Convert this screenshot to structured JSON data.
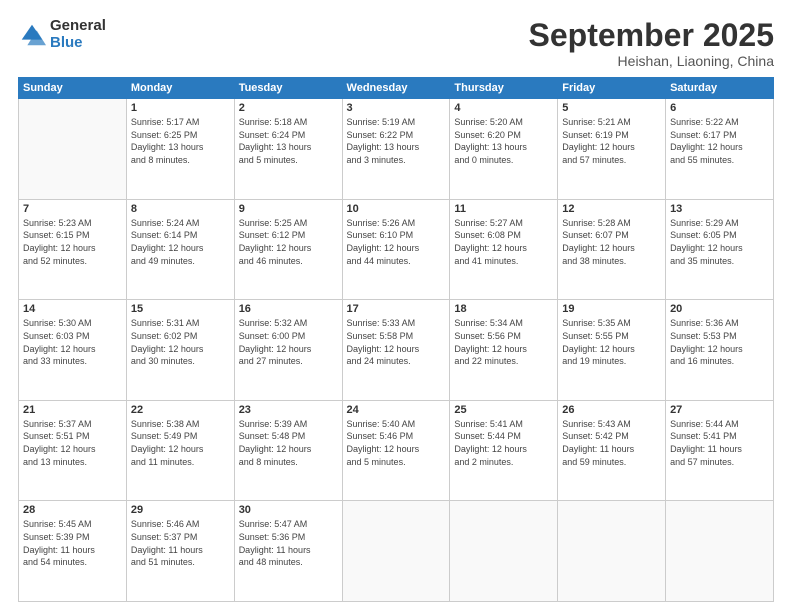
{
  "logo": {
    "general": "General",
    "blue": "Blue"
  },
  "title": "September 2025",
  "location": "Heishan, Liaoning, China",
  "days": [
    "Sunday",
    "Monday",
    "Tuesday",
    "Wednesday",
    "Thursday",
    "Friday",
    "Saturday"
  ],
  "weeks": [
    [
      {
        "date": "",
        "info": ""
      },
      {
        "date": "1",
        "info": "Sunrise: 5:17 AM\nSunset: 6:25 PM\nDaylight: 13 hours\nand 8 minutes."
      },
      {
        "date": "2",
        "info": "Sunrise: 5:18 AM\nSunset: 6:24 PM\nDaylight: 13 hours\nand 5 minutes."
      },
      {
        "date": "3",
        "info": "Sunrise: 5:19 AM\nSunset: 6:22 PM\nDaylight: 13 hours\nand 3 minutes."
      },
      {
        "date": "4",
        "info": "Sunrise: 5:20 AM\nSunset: 6:20 PM\nDaylight: 13 hours\nand 0 minutes."
      },
      {
        "date": "5",
        "info": "Sunrise: 5:21 AM\nSunset: 6:19 PM\nDaylight: 12 hours\nand 57 minutes."
      },
      {
        "date": "6",
        "info": "Sunrise: 5:22 AM\nSunset: 6:17 PM\nDaylight: 12 hours\nand 55 minutes."
      }
    ],
    [
      {
        "date": "7",
        "info": "Sunrise: 5:23 AM\nSunset: 6:15 PM\nDaylight: 12 hours\nand 52 minutes."
      },
      {
        "date": "8",
        "info": "Sunrise: 5:24 AM\nSunset: 6:14 PM\nDaylight: 12 hours\nand 49 minutes."
      },
      {
        "date": "9",
        "info": "Sunrise: 5:25 AM\nSunset: 6:12 PM\nDaylight: 12 hours\nand 46 minutes."
      },
      {
        "date": "10",
        "info": "Sunrise: 5:26 AM\nSunset: 6:10 PM\nDaylight: 12 hours\nand 44 minutes."
      },
      {
        "date": "11",
        "info": "Sunrise: 5:27 AM\nSunset: 6:08 PM\nDaylight: 12 hours\nand 41 minutes."
      },
      {
        "date": "12",
        "info": "Sunrise: 5:28 AM\nSunset: 6:07 PM\nDaylight: 12 hours\nand 38 minutes."
      },
      {
        "date": "13",
        "info": "Sunrise: 5:29 AM\nSunset: 6:05 PM\nDaylight: 12 hours\nand 35 minutes."
      }
    ],
    [
      {
        "date": "14",
        "info": "Sunrise: 5:30 AM\nSunset: 6:03 PM\nDaylight: 12 hours\nand 33 minutes."
      },
      {
        "date": "15",
        "info": "Sunrise: 5:31 AM\nSunset: 6:02 PM\nDaylight: 12 hours\nand 30 minutes."
      },
      {
        "date": "16",
        "info": "Sunrise: 5:32 AM\nSunset: 6:00 PM\nDaylight: 12 hours\nand 27 minutes."
      },
      {
        "date": "17",
        "info": "Sunrise: 5:33 AM\nSunset: 5:58 PM\nDaylight: 12 hours\nand 24 minutes."
      },
      {
        "date": "18",
        "info": "Sunrise: 5:34 AM\nSunset: 5:56 PM\nDaylight: 12 hours\nand 22 minutes."
      },
      {
        "date": "19",
        "info": "Sunrise: 5:35 AM\nSunset: 5:55 PM\nDaylight: 12 hours\nand 19 minutes."
      },
      {
        "date": "20",
        "info": "Sunrise: 5:36 AM\nSunset: 5:53 PM\nDaylight: 12 hours\nand 16 minutes."
      }
    ],
    [
      {
        "date": "21",
        "info": "Sunrise: 5:37 AM\nSunset: 5:51 PM\nDaylight: 12 hours\nand 13 minutes."
      },
      {
        "date": "22",
        "info": "Sunrise: 5:38 AM\nSunset: 5:49 PM\nDaylight: 12 hours\nand 11 minutes."
      },
      {
        "date": "23",
        "info": "Sunrise: 5:39 AM\nSunset: 5:48 PM\nDaylight: 12 hours\nand 8 minutes."
      },
      {
        "date": "24",
        "info": "Sunrise: 5:40 AM\nSunset: 5:46 PM\nDaylight: 12 hours\nand 5 minutes."
      },
      {
        "date": "25",
        "info": "Sunrise: 5:41 AM\nSunset: 5:44 PM\nDaylight: 12 hours\nand 2 minutes."
      },
      {
        "date": "26",
        "info": "Sunrise: 5:43 AM\nSunset: 5:42 PM\nDaylight: 11 hours\nand 59 minutes."
      },
      {
        "date": "27",
        "info": "Sunrise: 5:44 AM\nSunset: 5:41 PM\nDaylight: 11 hours\nand 57 minutes."
      }
    ],
    [
      {
        "date": "28",
        "info": "Sunrise: 5:45 AM\nSunset: 5:39 PM\nDaylight: 11 hours\nand 54 minutes."
      },
      {
        "date": "29",
        "info": "Sunrise: 5:46 AM\nSunset: 5:37 PM\nDaylight: 11 hours\nand 51 minutes."
      },
      {
        "date": "30",
        "info": "Sunrise: 5:47 AM\nSunset: 5:36 PM\nDaylight: 11 hours\nand 48 minutes."
      },
      {
        "date": "",
        "info": ""
      },
      {
        "date": "",
        "info": ""
      },
      {
        "date": "",
        "info": ""
      },
      {
        "date": "",
        "info": ""
      }
    ]
  ]
}
